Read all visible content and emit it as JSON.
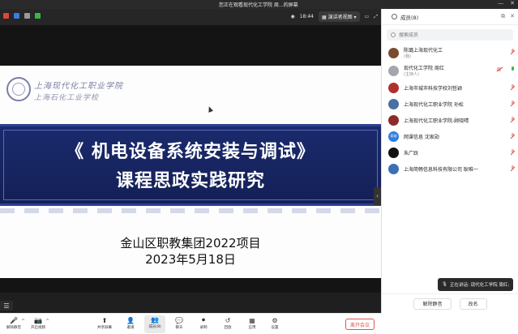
{
  "window": {
    "title": "您正在观看现代化工学院 周...的屏幕",
    "time": "18:44",
    "presenter_view_label": "演讲者视图"
  },
  "slide": {
    "logo_text_1": "上海现代化工职业学院",
    "logo_text_2": "上海石化工业学校",
    "title_line_1": "《 机电设备系统安装与调试》",
    "title_line_2": "课程思政实践研究",
    "subtitle_line_1": "金山区职教集团2022项目",
    "subtitle_line_2": "2023年5月18日"
  },
  "panel": {
    "header_title": "成员(8)",
    "search_placeholder": "搜索成员",
    "members": [
      {
        "name": "陈璐上海现代化工",
        "role": "(我)",
        "avatar_color": "#7a4b2e"
      },
      {
        "name": "现代化工学院 周红",
        "role": "(主持人)",
        "avatar_color": "#a3a7ad"
      },
      {
        "name": "上海市城市科技学校刘哲颖",
        "role": "",
        "avatar_color": "#b03030"
      },
      {
        "name": "上海现代化工职业学院 孙松",
        "role": "",
        "avatar_color": "#4a6fa5"
      },
      {
        "name": "上海现代化工职业学院-顾晓晴",
        "role": "",
        "avatar_color": "#8c2b2b"
      },
      {
        "name": "网课信息 沈家勋",
        "role": "",
        "avatar_color": "#2f7de1",
        "avatar_text": "家勋"
      },
      {
        "name": "朱广跃",
        "role": "",
        "avatar_color": "#111111"
      },
      {
        "name": "上海简畅信息科技有限公司 耿唯一",
        "role": "",
        "avatar_color": "#3d6fb6"
      }
    ],
    "speaking_label": "正在讲话: 现代化工学院 周红;",
    "mute_all_label": "解除静音",
    "rename_label": "改名"
  },
  "toolbar": {
    "items": [
      {
        "label": "解除静音",
        "icon": "mic-muted-icon"
      },
      {
        "label": "开启视频",
        "icon": "camera-off-icon"
      },
      {
        "label": "共享屏幕",
        "icon": "share-screen-icon"
      },
      {
        "label": "邀请",
        "icon": "invite-icon"
      },
      {
        "label": "成员(8)",
        "icon": "members-icon"
      },
      {
        "label": "聊天",
        "icon": "chat-icon"
      },
      {
        "label": "录制",
        "icon": "record-icon"
      },
      {
        "label": "回放",
        "icon": "replay-icon"
      },
      {
        "label": "应用",
        "icon": "apps-icon"
      },
      {
        "label": "设置",
        "icon": "settings-icon"
      }
    ],
    "end_label": "离开会议"
  },
  "colors": {
    "band_blue": "#1a2a6c",
    "end_red": "#e05353"
  }
}
